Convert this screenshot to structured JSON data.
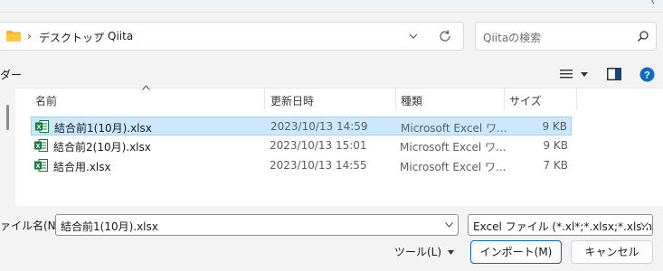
{
  "address": {
    "segments": [
      "デスクトップ",
      "Qiita"
    ],
    "separator": "›"
  },
  "search": {
    "placeholder": "Qiitaの検索"
  },
  "toolbar": {
    "label": "ダー"
  },
  "columns": {
    "name": "名前",
    "date": "更新日時",
    "type": "種類",
    "size": "サイズ"
  },
  "files": [
    {
      "name": "結合前1(10月).xlsx",
      "date": "2023/10/13 14:59",
      "type": "Microsoft Excel ワ...",
      "size": "9 KB",
      "selected": true
    },
    {
      "name": "結合前2(10月).xlsx",
      "date": "2023/10/13 15:01",
      "type": "Microsoft Excel ワ...",
      "size": "9 KB",
      "selected": false
    },
    {
      "name": "結合用.xlsx",
      "date": "2023/10/13 14:55",
      "type": "Microsoft Excel ワ...",
      "size": "7 KB",
      "selected": false
    }
  ],
  "filename": {
    "label": "ァイル名(N):",
    "value": "結合前1(10月).xlsx"
  },
  "filter": {
    "value": "Excel ファイル (*.xl*;*.xlsx;*.xlsm;*.xl"
  },
  "buttons": {
    "tools": "ツール(L)",
    "import": "インポート(M)",
    "cancel": "キャンセル"
  },
  "colors": {
    "accent": "#0067c0",
    "selection": "#cce8ff",
    "excel_green": "#107c41",
    "help_blue": "#0f6cbd"
  },
  "icons": [
    "folder-icon",
    "chevron-down-icon",
    "refresh-icon",
    "search-icon",
    "view-list-icon",
    "preview-pane-icon",
    "help-icon",
    "excel-file-icon"
  ]
}
